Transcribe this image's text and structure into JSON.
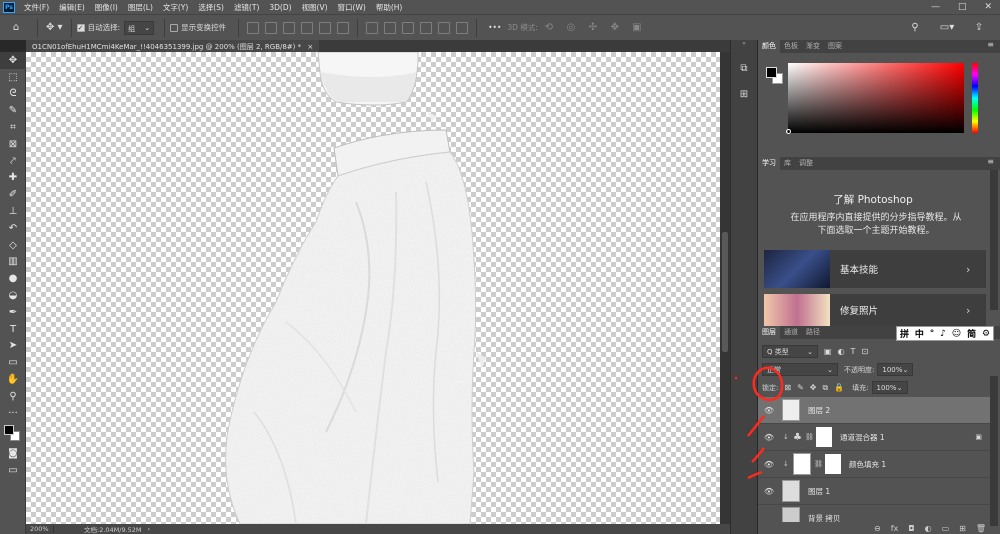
{
  "app": {
    "logo": "Ps"
  },
  "menubar": {
    "items": [
      "文件(F)",
      "编辑(E)",
      "图像(I)",
      "图层(L)",
      "文字(Y)",
      "选择(S)",
      "滤镜(T)",
      "3D(D)",
      "视图(V)",
      "窗口(W)",
      "帮助(H)"
    ],
    "window_controls": [
      "—",
      "□",
      "✕"
    ]
  },
  "options_bar": {
    "auto_select_label": "自动选择:",
    "auto_select_value": "组",
    "show_transform_label": "显示变换控件",
    "mode_3d_label": "3D 模式:",
    "more_label": "•••"
  },
  "document": {
    "tab_title": "O1CN01ofEhuH1MCmi4KeMar_!!4046351399.jpg @ 200% (图层 2, RGB/8#) *",
    "close": "×"
  },
  "status_bar": {
    "zoom": "200%",
    "doc_info": "文档:2.04M/9.52M"
  },
  "tools": [
    {
      "name": "move-tool",
      "glyph": "✥"
    },
    {
      "name": "marquee-tool",
      "glyph": "⬚"
    },
    {
      "name": "lasso-tool",
      "glyph": "ᘓ"
    },
    {
      "name": "quick-select-tool",
      "glyph": "✎"
    },
    {
      "name": "crop-tool",
      "glyph": "⌗"
    },
    {
      "name": "frame-tool",
      "glyph": "⊠"
    },
    {
      "name": "eyedropper-tool",
      "glyph": "⤤"
    },
    {
      "name": "healing-tool",
      "glyph": "✚"
    },
    {
      "name": "brush-tool",
      "glyph": "✐"
    },
    {
      "name": "stamp-tool",
      "glyph": "⊥"
    },
    {
      "name": "history-brush-tool",
      "glyph": "↶"
    },
    {
      "name": "eraser-tool",
      "glyph": "◇"
    },
    {
      "name": "gradient-tool",
      "glyph": "▥"
    },
    {
      "name": "blur-tool",
      "glyph": "●"
    },
    {
      "name": "dodge-tool",
      "glyph": "◒"
    },
    {
      "name": "pen-tool",
      "glyph": "✒"
    },
    {
      "name": "type-tool",
      "glyph": "T"
    },
    {
      "name": "path-select-tool",
      "glyph": "➤"
    },
    {
      "name": "shape-tool",
      "glyph": "▭"
    },
    {
      "name": "hand-tool",
      "glyph": "✋"
    },
    {
      "name": "zoom-tool",
      "glyph": "⚲"
    },
    {
      "name": "edit-toolbar",
      "glyph": "···"
    }
  ],
  "color_panel": {
    "tabs": [
      "颜色",
      "色板",
      "渐变",
      "图案"
    ],
    "hue_color": "#ff0000"
  },
  "learn_panel": {
    "tabs": [
      "学习",
      "库",
      "调整"
    ],
    "title": "了解 Photoshop",
    "description_line1": "在应用程序内直接提供的分步指导教程。从",
    "description_line2": "下面选取一个主题开始教程。",
    "cards": [
      {
        "label": "基本技能",
        "arrow": "›"
      },
      {
        "label": "修复照片",
        "arrow": "›"
      }
    ]
  },
  "layers_panel": {
    "tabs": [
      "图层",
      "通道",
      "路径"
    ],
    "filter_label": "Q 类型",
    "blend_mode": "正常",
    "opacity_label": "不透明度:",
    "opacity_value": "100%",
    "lock_label": "锁定:",
    "fill_label": "填充:",
    "fill_value": "100%",
    "layers": [
      {
        "name": "图层 2",
        "selected": true,
        "visible": true
      },
      {
        "name": "通道混合器 1",
        "selected": false,
        "visible": true
      },
      {
        "name": "颜色填充 1",
        "selected": false,
        "visible": true
      },
      {
        "name": "图层 1",
        "selected": false,
        "visible": true
      },
      {
        "name": "背景 拷贝",
        "selected": false,
        "visible": false
      }
    ],
    "bottom_icons": [
      "⊖",
      "fx",
      "◘",
      "◐",
      "▭",
      "⊞",
      "🗑"
    ]
  },
  "ime_toolbar": {
    "items": [
      "拼",
      "中",
      "°",
      "♪",
      "☺",
      "简",
      "⚙"
    ]
  },
  "colors": {
    "ui_bg": "#535353",
    "canvas_checker": "#cccccc",
    "annotation_red": "#ff2a1f"
  }
}
